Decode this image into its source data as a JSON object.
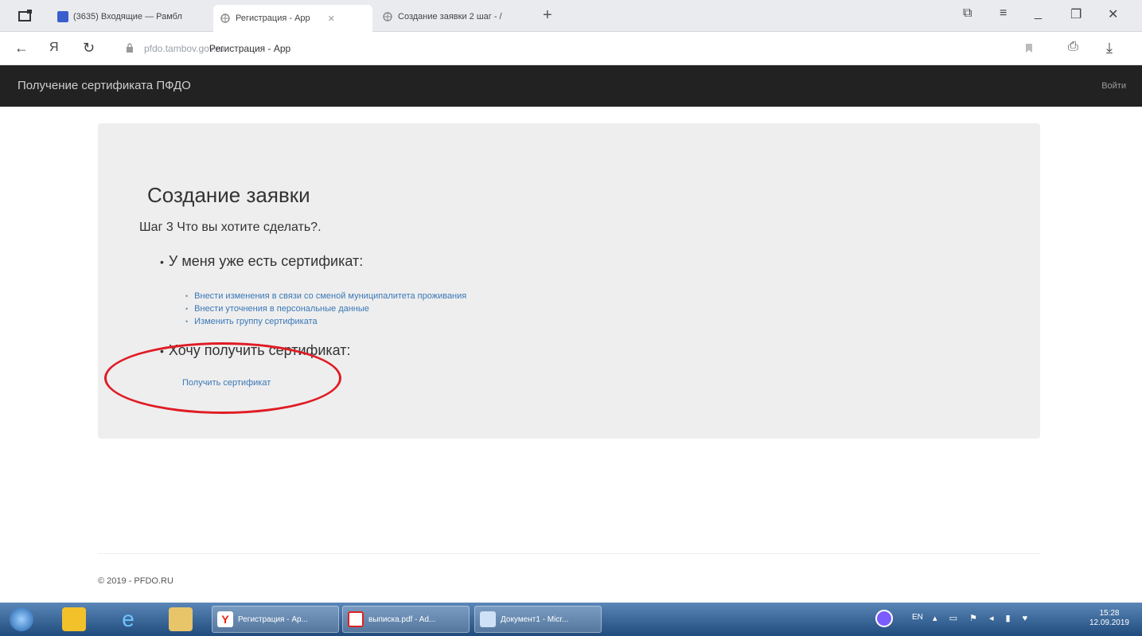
{
  "browser": {
    "tabs": [
      {
        "label": "(3635) Входящие — Рамбл",
        "active": false
      },
      {
        "label": "Регистрация - App",
        "active": true
      },
      {
        "label": "Создание заявки 2 шаг - /",
        "active": false
      }
    ],
    "address_domain": "pfdo.tambov.gov.ru",
    "address_title": "Регистрация - App"
  },
  "navbar": {
    "brand": "Получение сертификата ПФДО",
    "login": "Войти"
  },
  "main": {
    "title": "Создание заявки",
    "step": "Шаг 3 Что вы хотите сделать?.",
    "have_certificate": "У меня уже есть сертификат:",
    "have_options": [
      "Внести изменения в связи со сменой муниципалитета проживания",
      "Внести уточнения в персональные данные",
      "Изменить группу сертификата"
    ],
    "want_certificate": "Хочу получить сертификат:",
    "get_certificate_link": "Получить сертификат"
  },
  "footer": {
    "copyright": "© 2019 - PFDO.RU"
  },
  "taskbar": {
    "tasks": [
      {
        "label": "Регистрация - Ap..."
      },
      {
        "label": "выписка.pdf - Ad..."
      },
      {
        "label": "Документ1 - Micr..."
      }
    ],
    "lang": "EN",
    "time": "15:28",
    "date": "12.09.2019"
  },
  "colors": {
    "navbar": "#222222",
    "jumbotron": "#eeeeee",
    "link": "#3a78b8",
    "annotation": "#e01b24"
  }
}
